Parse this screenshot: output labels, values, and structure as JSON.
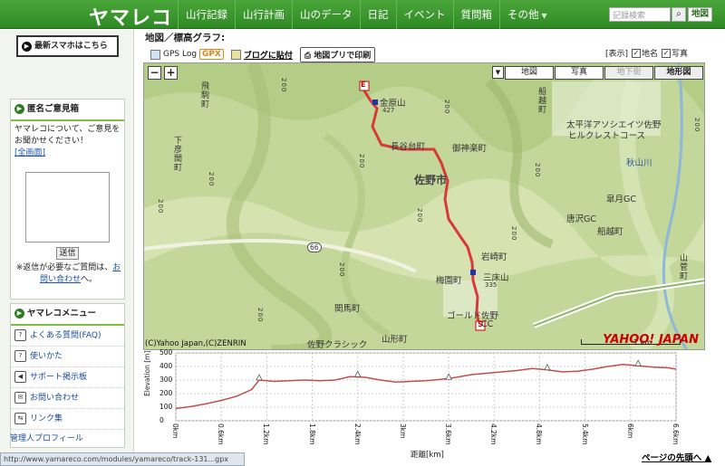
{
  "header": {
    "logo": "ヤマレコ",
    "nav": [
      "山行記録",
      "山行計画",
      "山のデータ",
      "日記",
      "イベント",
      "質問箱",
      "その他"
    ],
    "search_placeholder": "記録検索",
    "search_button_icon": "search-icon",
    "map_button": "地図"
  },
  "sidebar": {
    "mobile_button": "最新スマホはこちら",
    "opinion": {
      "title": "匿名ご意見箱",
      "text": "ヤマレコについて、ご意見をお聞かせください！",
      "full_link": "[全画面]",
      "send": "送信",
      "note_prefix": "※返信が必要なご質問は、",
      "note_link": "お問い合わせ",
      "note_suffix": "へ。"
    },
    "menu": {
      "title": "ヤマレコメニュー",
      "items": [
        {
          "label": "よくある質問(FAQ)",
          "icon": "question-icon"
        },
        {
          "label": "使いかた",
          "icon": "question-icon"
        },
        {
          "label": "サポート掲示板",
          "icon": "speaker-icon"
        },
        {
          "label": "お問い合わせ",
          "icon": "mail-icon"
        },
        {
          "label": "リンク集",
          "icon": "arrows-icon"
        }
      ]
    },
    "admin_profile": "管理人プロフィール"
  },
  "main": {
    "title": "地図／標高グラフ:",
    "toolbar": {
      "gps_log": "GPS Log",
      "gpx": "GPX",
      "blog": "ブログに貼付",
      "print": "地図プリで印刷"
    },
    "display": {
      "label": "[表示]",
      "chimei": "地名",
      "chimei_checked": "✓",
      "photo": "写真",
      "photo_checked": "✓"
    }
  },
  "map": {
    "zoom_out": "−",
    "zoom_in": "+",
    "layers": [
      "地図",
      "写真",
      "地下街",
      "地形図"
    ],
    "active_layer": "地形図",
    "labels": {
      "kanahara": "金原山",
      "kanahara_h": "427",
      "hasedai": "長谷台町",
      "gojin": "御神楽町",
      "sano": "佐野市",
      "iwasaki": "岩崎町",
      "umesono": "梅園町",
      "sanshou": "三床山",
      "sanshou_h": "335",
      "golf_sano": "ゴールド佐野",
      "cc": "CC",
      "sekima": "関馬町",
      "yamagata": "山形町",
      "sano_classic": "佐野クラシック",
      "hibari": "飛駒町",
      "shimohikoma": "下彦間町",
      "funakoshi1": "船越町",
      "funakoshi2": "船越町",
      "taiheiyo": "太平洋アソシエイツ佐野",
      "hillcrest": "ヒルクレストコース",
      "akiyama": "秋山川",
      "satsuki": "皐月GC",
      "karasawa": "唐沢GC",
      "yamasuge": "山菅町",
      "route66": "66",
      "start": "S",
      "end": "E"
    },
    "contours": [
      "200",
      "200",
      "200",
      "200",
      "200",
      "200",
      "200",
      "200",
      "200",
      "200",
      "200"
    ],
    "copyright": "(C)Yahoo Japan,(C)ZENRIN",
    "scale": "1 km",
    "brand": "YAHOO! JAPAN",
    "route_color": "#d63a3a"
  },
  "chart_data": {
    "type": "line",
    "title": "",
    "xlabel": "距離[km]",
    "ylabel": "Elevation [m]",
    "xlim": [
      0,
      6.6
    ],
    "ylim": [
      0,
      500
    ],
    "xticks": [
      "0km",
      "0.6km",
      "1.2km",
      "1.8km",
      "2.4km",
      "3km",
      "3.6km",
      "4.2km",
      "4.8km",
      "5.4km",
      "6km",
      "6.6km"
    ],
    "yticks": [
      "0",
      "100",
      "200",
      "300",
      "400",
      "500"
    ],
    "x": [
      0,
      0.2,
      0.4,
      0.6,
      0.8,
      1.0,
      1.1,
      1.3,
      1.5,
      1.7,
      1.9,
      2.1,
      2.3,
      2.5,
      2.7,
      2.9,
      3.1,
      3.3,
      3.5,
      3.7,
      3.9,
      4.1,
      4.3,
      4.5,
      4.7,
      4.9,
      5.1,
      5.3,
      5.5,
      5.7,
      5.9,
      6.1,
      6.3,
      6.5,
      6.6
    ],
    "values": [
      90,
      105,
      125,
      150,
      180,
      230,
      300,
      290,
      295,
      300,
      295,
      300,
      325,
      320,
      300,
      285,
      290,
      295,
      305,
      320,
      340,
      350,
      360,
      370,
      385,
      375,
      360,
      365,
      380,
      400,
      415,
      405,
      395,
      390,
      380
    ],
    "markers_x": [
      1.1,
      2.4,
      3.6,
      4.9,
      6.1
    ],
    "line_color": "#c0504d",
    "grid": true
  }
}
